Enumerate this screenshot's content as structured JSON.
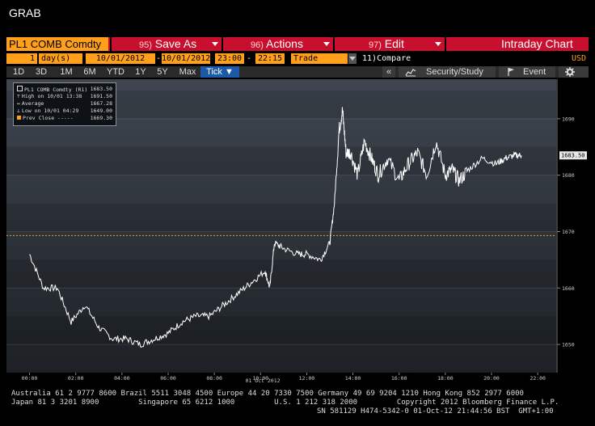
{
  "window": {
    "title": "GRAB"
  },
  "toolbar": {
    "ticker": "PL1 COMB Comdty",
    "save_as_num": "95)",
    "save_as_label": "Save As",
    "actions_num": "96)",
    "actions_label": "Actions",
    "edit_num": "97)",
    "edit_label": "Edit",
    "view_title": "Intraday Chart"
  },
  "params": {
    "period_count": "1",
    "period_unit": "day(s)",
    "start_date": "10/01/2012",
    "end_date": "10/01/2012",
    "start_time": "23:00",
    "end_time": "22:15",
    "event_type": "Trade",
    "compare_num": "11)",
    "compare_label": "Compare",
    "currency": "USD"
  },
  "tabs": [
    "1D",
    "3D",
    "1M",
    "6M",
    "YTD",
    "1Y",
    "5Y",
    "Max",
    "Tick ▼"
  ],
  "active_tab": "Tick ▼",
  "tools": {
    "collapse": "«",
    "security_study": "Security/Study",
    "event": "Event",
    "settings_icon": "gear-icon"
  },
  "legend": {
    "title": "PL1 COMB Comdty (R1)",
    "title_val": "1683.50",
    "high_label": "High on 10/01 13:38",
    "high_val": "1691.50",
    "avg_label": "Average",
    "avg_val": "1667.28",
    "low_label": "Low on 10/01 04:29",
    "low_val": "1649.00",
    "prev_label": "Prev Close -----",
    "prev_val": "1669.30"
  },
  "chart_data": {
    "type": "line",
    "series": [
      {
        "x": [
          0,
          0.6,
          1.2,
          1.8,
          2.4,
          3.0,
          3.6,
          4.2,
          4.8,
          5.4,
          6.0,
          6.6,
          7.2,
          7.8,
          8.4,
          9.0,
          9.6,
          10.2,
          10.4,
          10.6,
          11.0,
          11.6,
          12.0,
          12.6,
          13.0,
          13.2,
          13.4,
          13.55,
          13.7,
          13.9,
          14.2,
          14.5,
          14.8,
          15.1,
          15.5,
          16.0,
          16.4,
          16.8,
          17.2,
          17.6,
          18.0,
          18.3,
          18.6,
          19.0,
          19.6,
          20.2,
          20.6,
          21.0,
          21.3
        ],
        "y": [
          1666,
          1660,
          1660,
          1654,
          1657,
          1653,
          1651,
          1651,
          1650,
          1651,
          1652,
          1654,
          1655,
          1655,
          1657,
          1659,
          1661,
          1663,
          1660,
          1668,
          1667,
          1666,
          1666,
          1665,
          1668,
          1675,
          1688,
          1691.5,
          1684,
          1684,
          1680,
          1686,
          1683,
          1680,
          1683,
          1679,
          1682,
          1684,
          1680,
          1686,
          1680,
          1681,
          1679,
          1681,
          1683,
          1682,
          1683,
          1683.5,
          1683.5
        ],
        "color": "#ffffff"
      }
    ],
    "x_ticks": [
      "00:00",
      "02:00",
      "04:00",
      "06:00",
      "08:00",
      "10:00",
      "12:00",
      "14:00",
      "16:00",
      "18:00",
      "20:00",
      "22:00"
    ],
    "x_date_label": "01 Oct 2012",
    "y_ticks": [
      1650,
      1660,
      1670,
      1680,
      1690
    ],
    "ylim": [
      1645,
      1697
    ],
    "xlim": [
      -1,
      22.8
    ],
    "prev_close": 1669.3,
    "last_price_label": "1683.50",
    "prev_close_color": "#ff9f1a"
  },
  "footer": {
    "line1": "Australia 61 2 9777 8600 Brazil 5511 3048 4500 Europe 44 20 7330 7500 Germany 49 69 9204 1210 Hong Kong 852 2977 6000",
    "line2": "Japan 81 3 3201 8900         Singapore 65 6212 1000         U.S. 1 212 318 2000         Copyright 2012 Bloomberg Finance L.P.",
    "line3": "SN 581129 H474-5342-0 01-Oct-12 21:44:56 BST  GMT+1:00"
  }
}
